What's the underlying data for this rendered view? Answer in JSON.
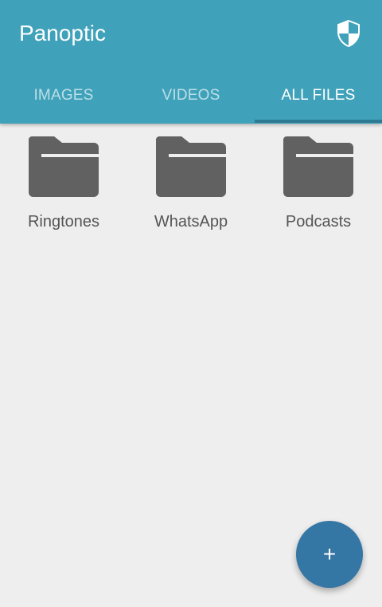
{
  "app": {
    "title": "Panoptic",
    "shield_icon": "shield-icon"
  },
  "tabs": [
    {
      "label": "IMAGES",
      "active": false
    },
    {
      "label": "VIDEOS",
      "active": false
    },
    {
      "label": "ALL FILES",
      "active": true
    }
  ],
  "folders": [
    {
      "name": "Ringtones",
      "icon": "folder-icon"
    },
    {
      "name": "WhatsApp",
      "icon": "folder-icon"
    },
    {
      "name": "Podcasts",
      "icon": "folder-icon"
    }
  ],
  "fab": {
    "label": "+",
    "icon": "plus-icon"
  },
  "colors": {
    "appbar": "#40a2ba",
    "tab_indicator": "#2d7a93",
    "fab": "#3476a4",
    "folder": "#616161",
    "background": "#eeeeee"
  }
}
